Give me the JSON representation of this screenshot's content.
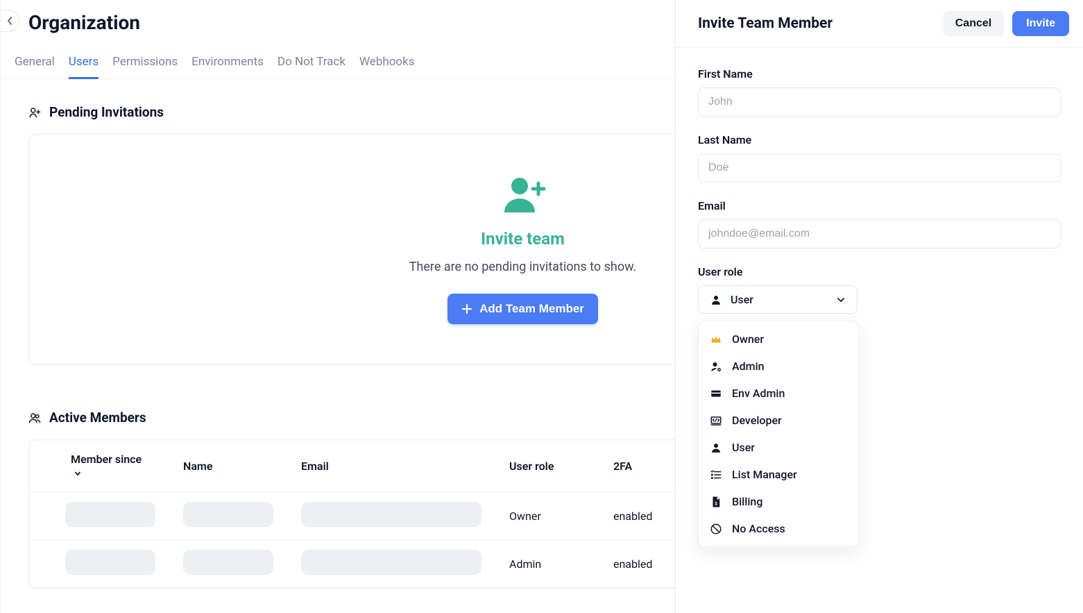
{
  "page": {
    "title": "Organization"
  },
  "tabs": [
    {
      "label": "General",
      "active": false
    },
    {
      "label": "Users",
      "active": true
    },
    {
      "label": "Permissions",
      "active": false
    },
    {
      "label": "Environments",
      "active": false
    },
    {
      "label": "Do Not Track",
      "active": false
    },
    {
      "label": "Webhooks",
      "active": false
    }
  ],
  "pending": {
    "section_title": "Pending Invitations",
    "hero_title": "Invite team",
    "hero_sub": "There are no pending invitations to show.",
    "add_button": "Add Team Member"
  },
  "active_members": {
    "section_title": "Active Members",
    "columns": {
      "member_since": "Member since",
      "name": "Name",
      "email": "Email",
      "role": "User role",
      "twofa": "2FA"
    },
    "rows": [
      {
        "role": "Owner",
        "twofa": "enabled"
      },
      {
        "role": "Admin",
        "twofa": "enabled"
      }
    ]
  },
  "drawer": {
    "title": "Invite Team Member",
    "cancel": "Cancel",
    "invite": "Invite",
    "fields": {
      "first_name": {
        "label": "First Name",
        "placeholder": "John"
      },
      "last_name": {
        "label": "Last Name",
        "placeholder": "Doe"
      },
      "email": {
        "label": "Email",
        "placeholder": "johndoe@email.com"
      },
      "role": {
        "label": "User role",
        "selected": "User"
      }
    },
    "role_options": [
      {
        "label": "Owner",
        "icon": "crown"
      },
      {
        "label": "Admin",
        "icon": "user-cog"
      },
      {
        "label": "Env Admin",
        "icon": "card"
      },
      {
        "label": "Developer",
        "icon": "code"
      },
      {
        "label": "User",
        "icon": "user"
      },
      {
        "label": "List Manager",
        "icon": "list"
      },
      {
        "label": "Billing",
        "icon": "file"
      },
      {
        "label": "No Access",
        "icon": "ban"
      }
    ]
  }
}
